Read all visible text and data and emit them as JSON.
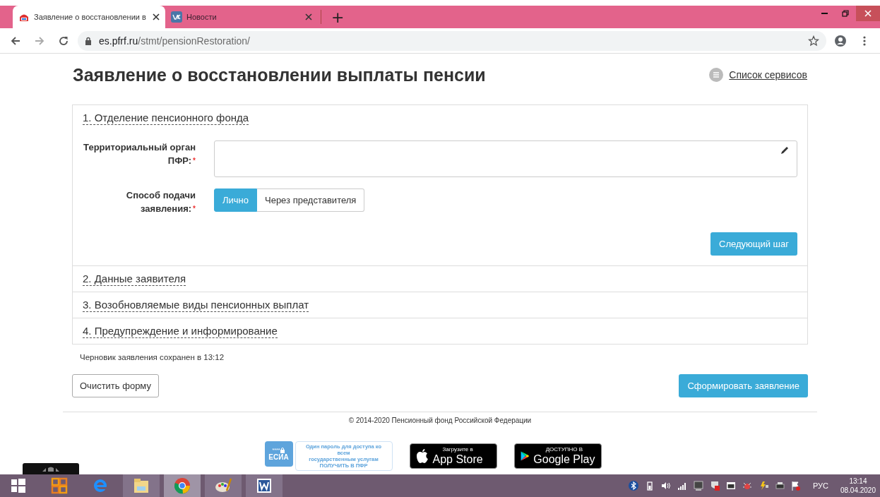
{
  "browser": {
    "tabs": [
      {
        "title": "Заявление о восстановлении в",
        "kind": "emblem",
        "selected": true
      },
      {
        "title": "Новости",
        "kind": "app",
        "selected": false
      }
    ],
    "new_tab": "+",
    "url_host": "es.pfrf.ru",
    "url_path": "/stmt/pensionRestoration/"
  },
  "page": {
    "title": "Заявление о восстановлении выплаты пенсии",
    "services_link": "Список сервисов",
    "sections": [
      {
        "title": "1. Отделение пенсионного фонда",
        "expanded": true,
        "fields": [
          {
            "kind": "text",
            "label": "Территориальный орган ПФР:",
            "required_mark": "*"
          },
          {
            "kind": "toggle",
            "label": "Способ подачи заявления:",
            "required_mark": "*",
            "options": [
              {
                "label": "Лично",
                "selected": true
              },
              {
                "label": "Через представителя",
                "selected": false
              }
            ]
          }
        ],
        "next_button": "Следующий шаг"
      },
      {
        "title": "2. Данные заявителя",
        "expanded": false
      },
      {
        "title": "3. Возобновляемые виды пенсионных выплат",
        "expanded": false
      },
      {
        "title": "4. Предупреждение и информирование",
        "expanded": false
      }
    ],
    "draft_note": "Черновик заявления сохранен в 13:12",
    "clear_button": "Очистить форму",
    "submit_button": "Сформировать заявление"
  },
  "footer": {
    "copyright": "© 2014-2020 Пенсионный фонд Российской Федерации",
    "esia": {
      "mask": "****",
      "name": "ЕСИА",
      "lines": [
        "Один пароль для доступа ко всем",
        "государственным услугам",
        "ПОЛУЧИТЬ В ПФР"
      ]
    },
    "stores": [
      {
        "kind": "apple",
        "small": "Загрузите в",
        "big": "App Store"
      },
      {
        "kind": "play",
        "small": "ДОСТУПНО В",
        "big": "Google Play"
      }
    ]
  },
  "taskbar": {
    "apps": [
      {
        "kind": "start",
        "running": false,
        "selected": false
      },
      {
        "kind": "office",
        "running": false,
        "selected": false
      },
      {
        "kind": "ie",
        "running": false,
        "selected": false
      },
      {
        "kind": "folder",
        "running": true,
        "selected": false
      },
      {
        "kind": "chrome",
        "running": true,
        "selected": true
      },
      {
        "kind": "paint",
        "running": true,
        "selected": false
      },
      {
        "kind": "word",
        "running": true,
        "selected": false
      }
    ],
    "language": "РУС",
    "time": "13:14",
    "date": "08.04.2020"
  }
}
